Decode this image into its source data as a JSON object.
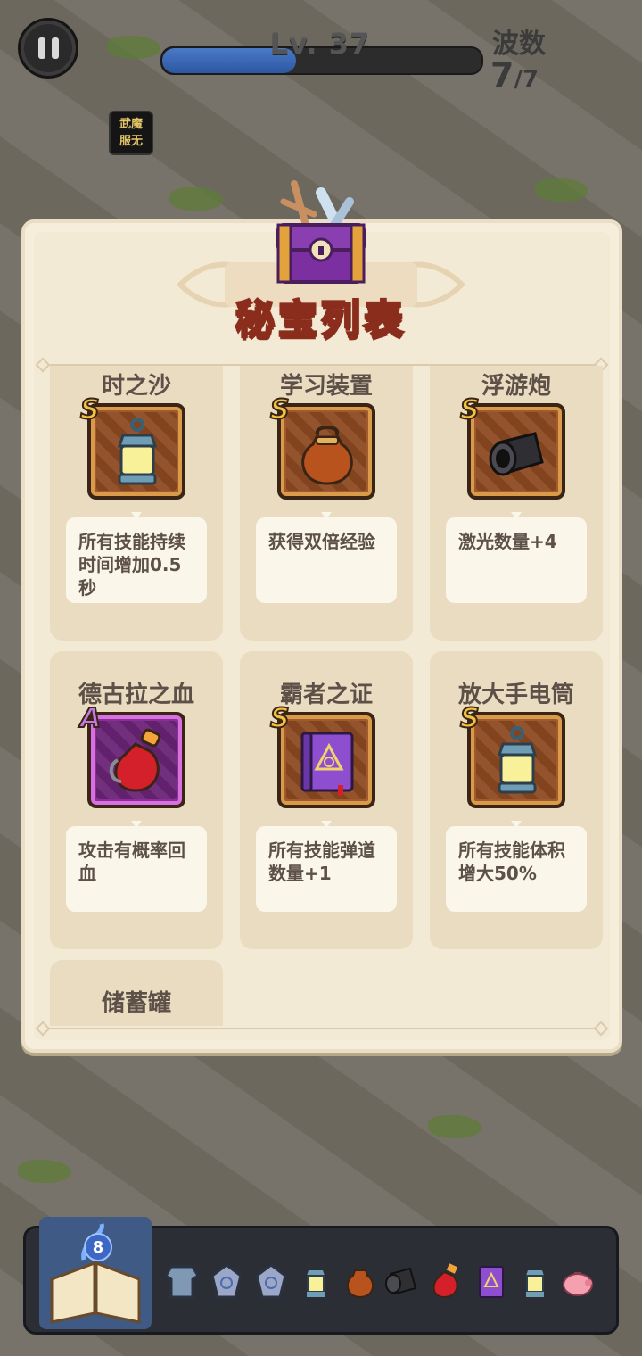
{
  "hud": {
    "level_text": "Lv. 37",
    "level_progress": 0.42,
    "wave_label": "波数",
    "wave_current": "7",
    "wave_total": "/7",
    "badge_line1": "武魔",
    "badge_line2": "服无"
  },
  "panel": {
    "title": "秘宝列表"
  },
  "treasures": [
    {
      "name": "时之沙",
      "rarity": "S",
      "icon": "lantern-icon",
      "desc": "所有技能持续时间增加0.5秒"
    },
    {
      "name": "学习装置",
      "rarity": "S",
      "icon": "money-bag-icon",
      "desc": "获得双倍经验"
    },
    {
      "name": "浮游炮",
      "rarity": "S",
      "icon": "cannon-icon",
      "desc": "激光数量+4"
    },
    {
      "name": "德古拉之血",
      "rarity": "A",
      "icon": "blood-vial-icon",
      "desc": "攻击有概率回血"
    },
    {
      "name": "霸者之证",
      "rarity": "S",
      "icon": "purple-book-icon",
      "desc": "所有技能弹道数量+1"
    },
    {
      "name": "放大手电筒",
      "rarity": "S",
      "icon": "lantern-icon",
      "desc": "所有技能体积增大50%"
    },
    {
      "name": "储蓄罐"
    }
  ],
  "bottom_bar": {
    "spell_count": "8",
    "inventory_icons": [
      "armor-icon",
      "rune-stone-icon",
      "rune-stone-icon",
      "lantern-icon",
      "money-bag-icon",
      "cannon-icon",
      "blood-vial-icon",
      "purple-book-icon",
      "lantern-icon",
      "piggy-bank-icon"
    ]
  }
}
